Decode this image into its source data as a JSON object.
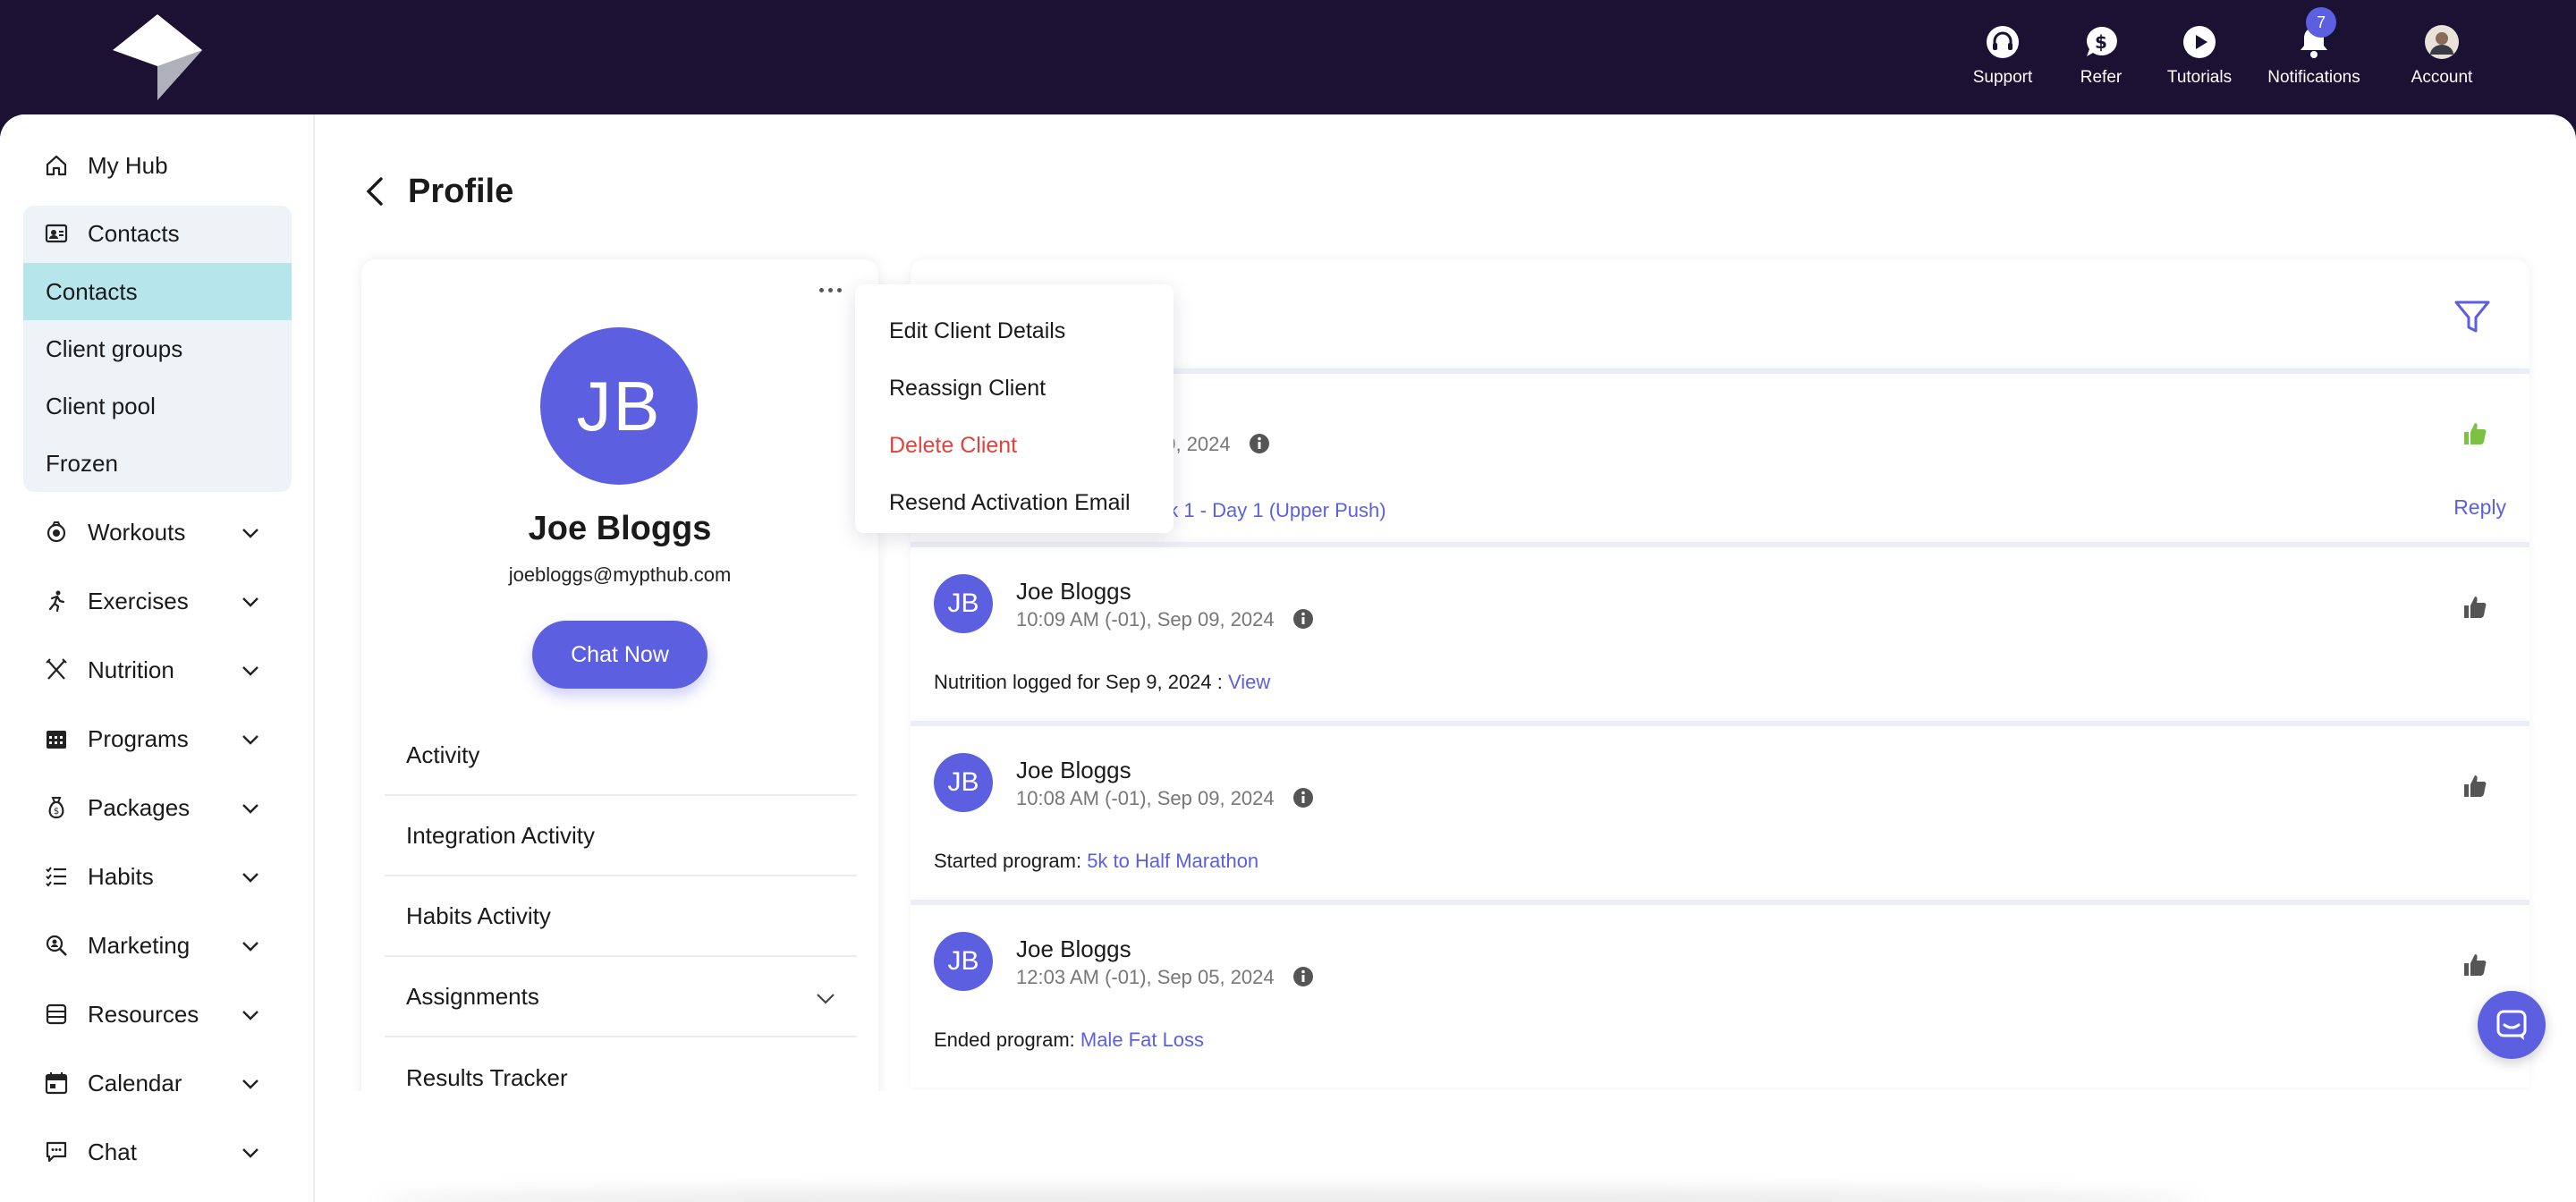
{
  "topnav": {
    "support": "Support",
    "refer": "Refer",
    "tutorials": "Tutorials",
    "notifications": "Notifications",
    "notifications_count": "7",
    "account": "Account"
  },
  "sidebar": {
    "my_hub": "My Hub",
    "contacts": "Contacts",
    "sub": [
      "Contacts",
      "Client groups",
      "Client pool",
      "Frozen"
    ],
    "workouts": "Workouts",
    "exercises": "Exercises",
    "nutrition": "Nutrition",
    "programs": "Programs",
    "packages": "Packages",
    "habits": "Habits",
    "marketing": "Marketing",
    "resources": "Resources",
    "calendar": "Calendar",
    "chat": "Chat"
  },
  "page": {
    "title": "Profile"
  },
  "profile": {
    "initials": "JB",
    "name": "Joe Bloggs",
    "email": "joebloggs@mypthub.com",
    "chat_button": "Chat Now",
    "sections": [
      "Activity",
      "Integration Activity",
      "Habits Activity",
      "Assignments",
      "Results Tracker"
    ]
  },
  "menu": {
    "items": [
      "Edit Client Details",
      "Reassign Client",
      "Delete Client",
      "Resend Activation Email"
    ]
  },
  "feed": {
    "items": [
      {
        "time_partial": "09, 2024",
        "text_partial_link": "ek 1 - Day 1 (Upper Push)",
        "reply": "Reply",
        "liked": true
      },
      {
        "initials": "JB",
        "name": "Joe Bloggs",
        "time": "10:09 AM (-01), Sep 09, 2024",
        "text": "Nutrition logged for Sep 9, 2024 : ",
        "link": "View"
      },
      {
        "initials": "JB",
        "name": "Joe Bloggs",
        "time": "10:08 AM (-01), Sep 09, 2024",
        "text": "Started program: ",
        "link": "5k to Half Marathon"
      },
      {
        "initials": "JB",
        "name": "Joe Bloggs",
        "time": "12:03 AM (-01), Sep 05, 2024",
        "text": "Ended program: ",
        "link": "Male Fat Loss"
      }
    ]
  },
  "colors": {
    "brand_dark": "#1a1133",
    "accent": "#5b5fe0",
    "active_nav": "#b6e6ec",
    "danger": "#e0433c",
    "like_green": "#7cc242"
  }
}
